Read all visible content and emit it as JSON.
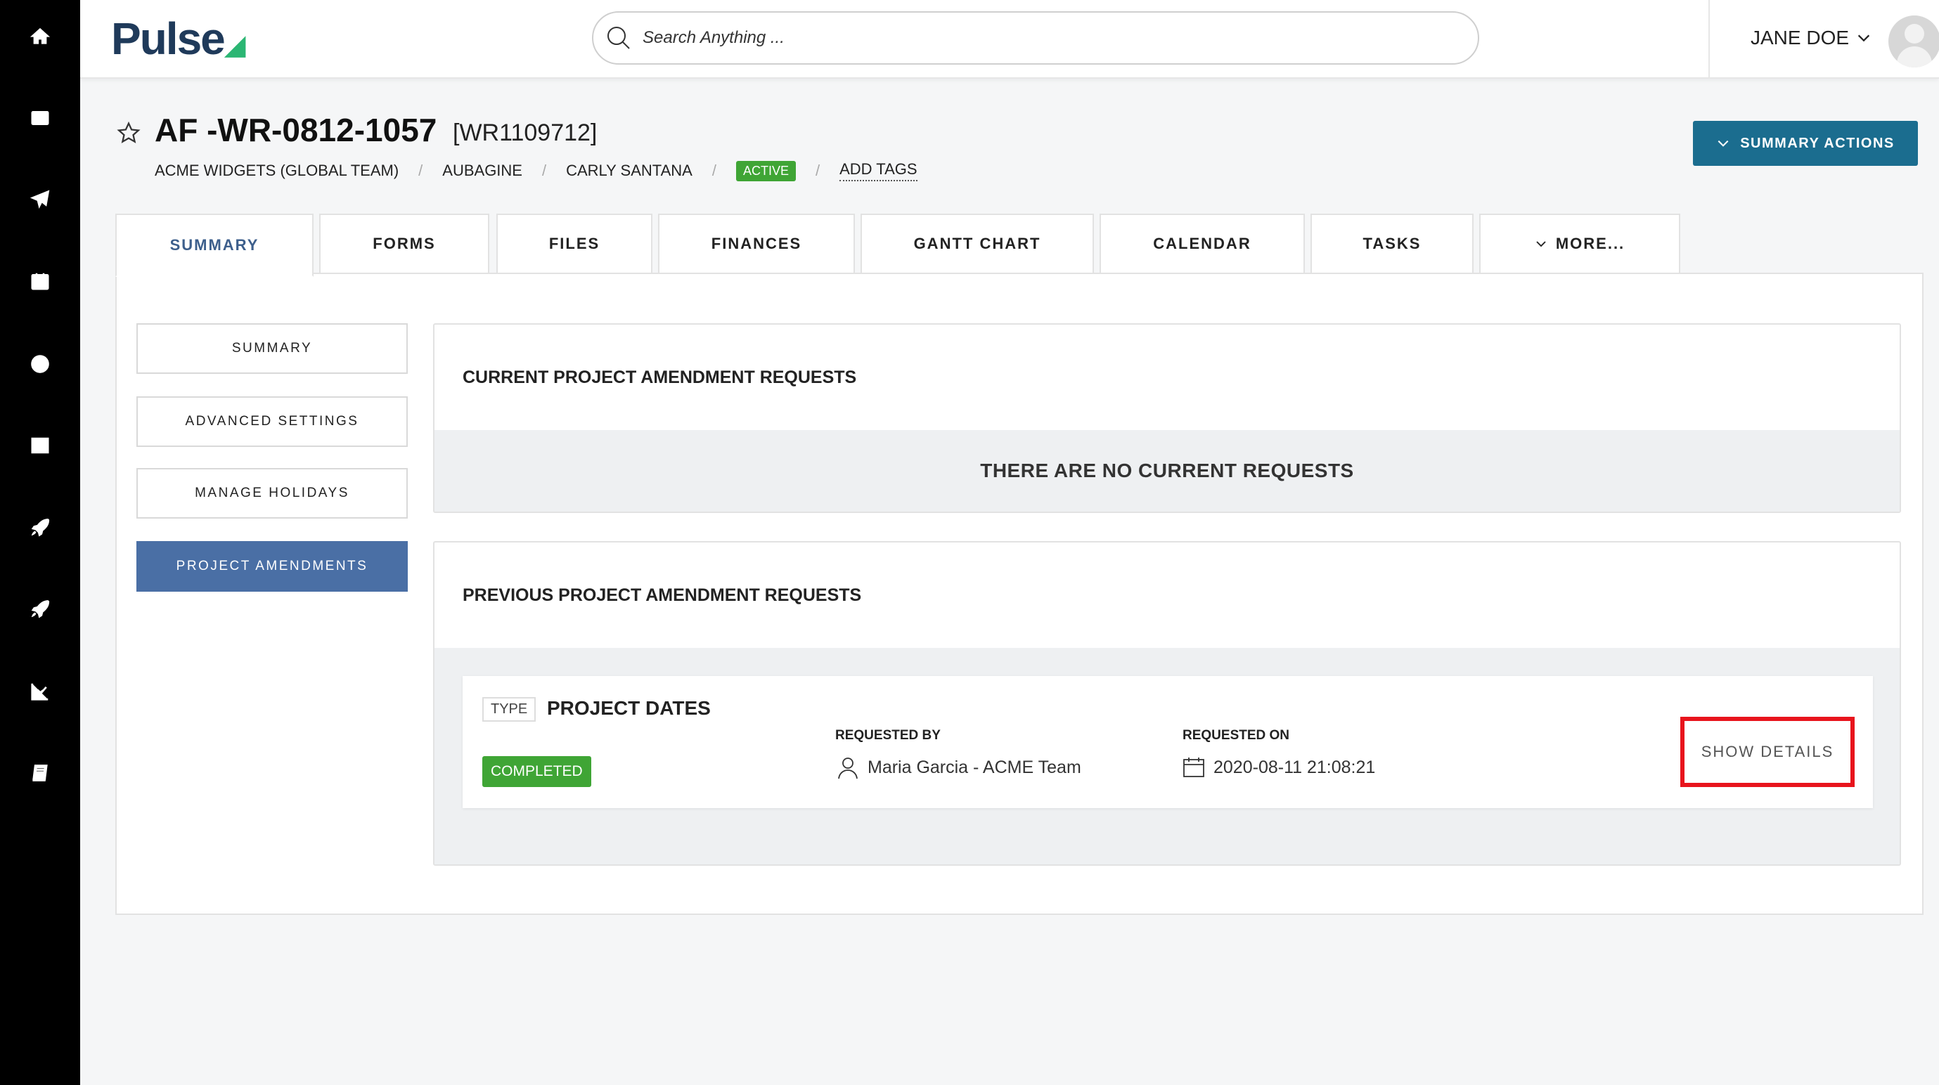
{
  "app": {
    "logo": "Pulse"
  },
  "search": {
    "placeholder": "Search Anything ..."
  },
  "user": {
    "name": "JANE DOE"
  },
  "project": {
    "title": "AF -WR-0812-1057",
    "code": "[WR1109712]",
    "breadcrumbs": [
      "ACME WIDGETS (GLOBAL TEAM)",
      "AUBAGINE",
      "CARLY SANTANA"
    ],
    "status": "ACTIVE",
    "add_tags": "ADD TAGS"
  },
  "summary_actions": "SUMMARY ACTIONS",
  "tabs": [
    {
      "label": "SUMMARY"
    },
    {
      "label": "FORMS"
    },
    {
      "label": "FILES"
    },
    {
      "label": "FINANCES"
    },
    {
      "label": "GANTT CHART"
    },
    {
      "label": "CALENDAR"
    },
    {
      "label": "TASKS"
    },
    {
      "label": "MORE..."
    }
  ],
  "side_menu": [
    "SUMMARY",
    "ADVANCED SETTINGS",
    "MANAGE HOLIDAYS",
    "PROJECT AMENDMENTS"
  ],
  "current_requests": {
    "heading": "CURRENT PROJECT AMENDMENT REQUESTS",
    "empty": "THERE ARE NO CURRENT REQUESTS"
  },
  "previous_requests": {
    "heading": "PREVIOUS PROJECT AMENDMENT REQUESTS",
    "items": [
      {
        "type_label": "TYPE",
        "type": "PROJECT DATES",
        "status": "COMPLETED",
        "requested_by_label": "REQUESTED BY",
        "requested_by": "Maria Garcia - ACME Team",
        "requested_on_label": "REQUESTED ON",
        "requested_on": "2020-08-11 21:08:21",
        "action": "SHOW DETAILS"
      }
    ]
  },
  "colors": {
    "brand": "#1f3a5a",
    "accent": "#1b6d8f",
    "active_nav": "#4a6fa5",
    "success": "#3fa535",
    "highlight": "#e8141c"
  }
}
